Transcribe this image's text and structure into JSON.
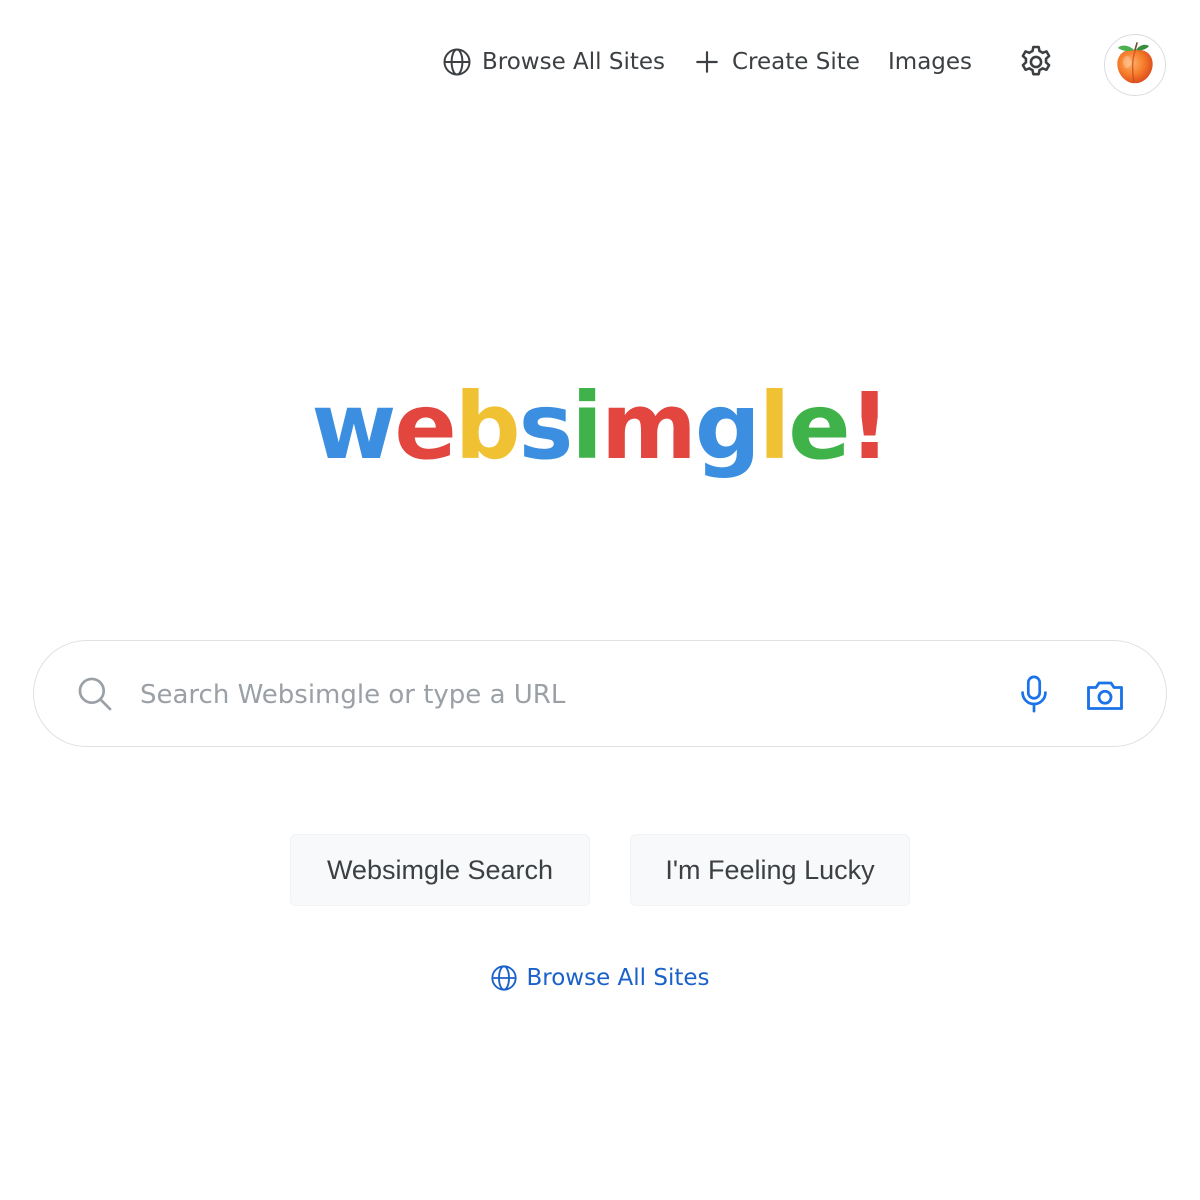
{
  "nav": {
    "browse_label": "Browse All Sites",
    "browse_icon": "globe-icon",
    "create_label": "Create Site",
    "create_icon": "plus-icon",
    "images_label": "Images",
    "settings_icon": "gear-icon",
    "avatar_icon": "peach-avatar-icon"
  },
  "logo": {
    "letters": [
      {
        "char": "w",
        "color": "#3b8ee0"
      },
      {
        "char": "e",
        "color": "#e2463f"
      },
      {
        "char": "b",
        "color": "#f0c233"
      },
      {
        "char": "s",
        "color": "#3b8ee0"
      },
      {
        "char": "i",
        "color": "#40b24a"
      },
      {
        "char": "m",
        "color": "#e2463f"
      },
      {
        "char": "g",
        "color": "#3b8ee0"
      },
      {
        "char": "l",
        "color": "#f0c233"
      },
      {
        "char": "e",
        "color": "#40b24a"
      },
      {
        "char": "!",
        "color": "#e2463f"
      }
    ]
  },
  "search": {
    "placeholder": "Search Websimgle or type a URL",
    "value": "",
    "search_icon": "search-icon",
    "mic_icon": "microphone-icon",
    "camera_icon": "camera-icon"
  },
  "buttons": {
    "search_label": "Websimgle Search",
    "lucky_label": "I'm Feeling Lucky"
  },
  "bottom_link": {
    "label": "Browse All Sites",
    "icon": "globe-icon"
  },
  "colors": {
    "link_blue": "#1a61c9",
    "icon_blue": "#1a73e8",
    "text_dark": "#3c4043",
    "placeholder": "#9aa0a6"
  }
}
